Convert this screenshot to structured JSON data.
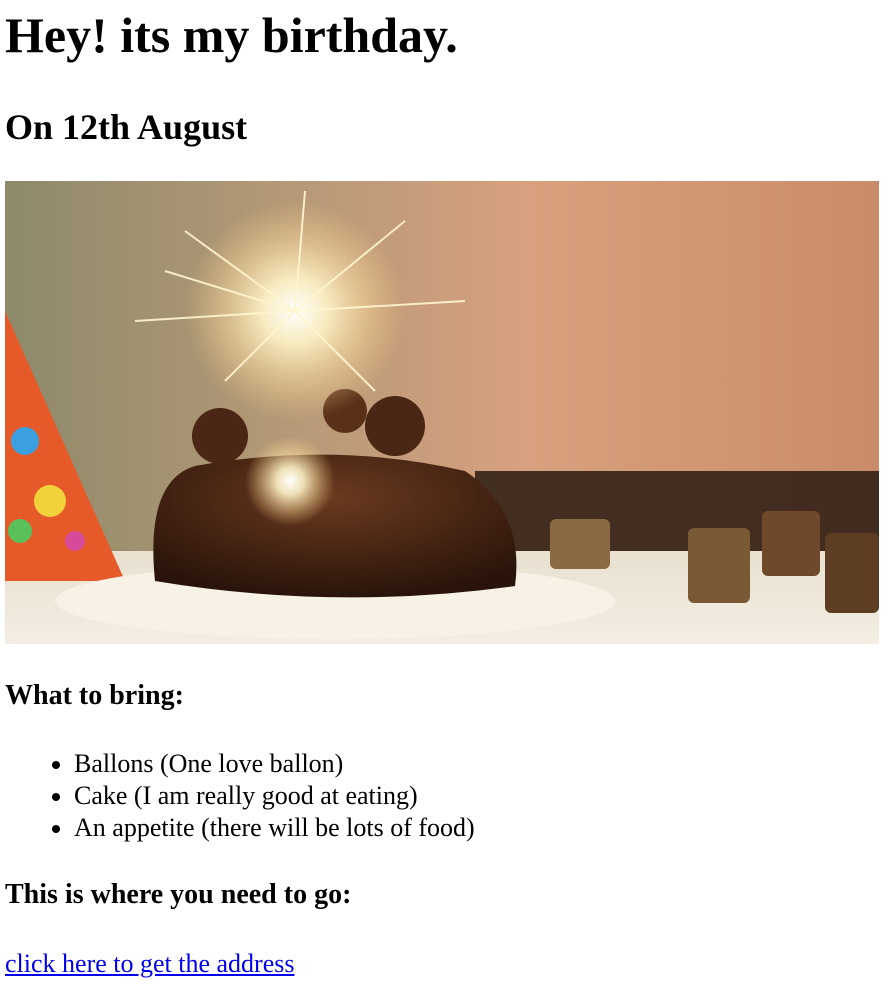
{
  "header": {
    "title": "Hey! its my birthday.",
    "date": "On 12th August"
  },
  "image": {
    "icon": "birthday-cake-sparkler-photo"
  },
  "bring": {
    "heading": "What to bring:",
    "items": [
      "Ballons (One love ballon)",
      "Cake (I am really good at eating)",
      "An appetite (there will be lots of food)"
    ]
  },
  "where": {
    "heading": "This is where you need to go:",
    "link_label": "click here to get the address"
  },
  "colors": {
    "link": "#0000ee",
    "text": "#000000",
    "background": "#ffffff"
  }
}
